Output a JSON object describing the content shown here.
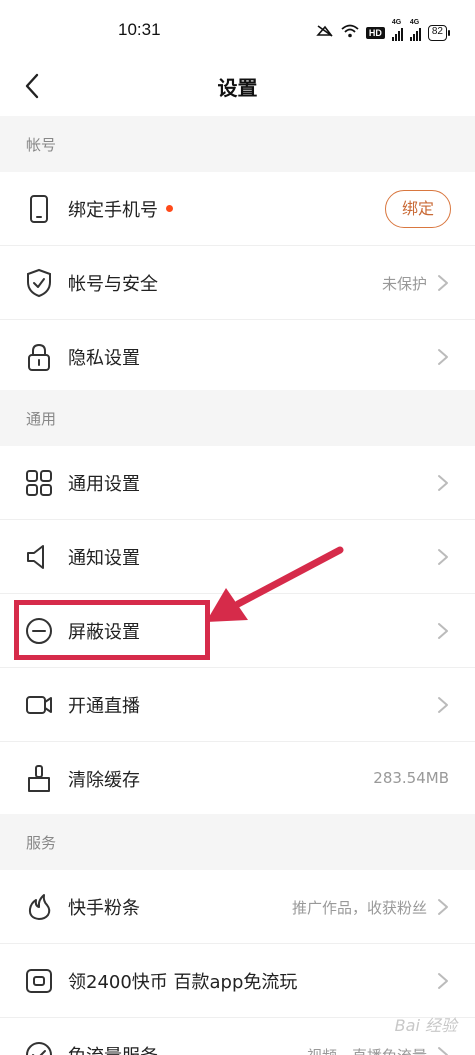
{
  "status_bar": {
    "time": "10:31",
    "network_gen": "4G",
    "hd_label": "HD",
    "battery": "82"
  },
  "nav": {
    "title": "设置"
  },
  "sections": {
    "account": {
      "header": "帐号",
      "bind_phone": {
        "label": "绑定手机号",
        "button": "绑定"
      },
      "account_security": {
        "label": "帐号与安全",
        "value": "未保护"
      },
      "privacy": {
        "label": "隐私设置"
      }
    },
    "general": {
      "header": "通用",
      "general_settings": {
        "label": "通用设置"
      },
      "notification_settings": {
        "label": "通知设置"
      },
      "block_settings": {
        "label": "屏蔽设置"
      },
      "live_stream": {
        "label": "开通直播"
      },
      "clear_cache": {
        "label": "清除缓存",
        "value": "283.54MB"
      }
    },
    "services": {
      "header": "服务",
      "fans": {
        "label": "快手粉条",
        "value": "推广作品，收获粉丝"
      },
      "coins": {
        "label": "领2400快币 百款app免流玩"
      },
      "free_data": {
        "label": "免流量服务",
        "value": "视频、直播免流量"
      }
    }
  },
  "watermark": "Bai 经验",
  "colors": {
    "accent_dot": "#ff4a1a",
    "bind_button": "#d9773f",
    "highlight": "#d62b4a"
  },
  "icons": {
    "back": "chevron-left-icon",
    "phone": "phone-icon",
    "shield": "shield-check-icon",
    "lock": "lock-icon",
    "grid": "grid-icon",
    "speaker": "speaker-icon",
    "block": "block-icon",
    "camera": "video-camera-icon",
    "broom": "broom-icon",
    "fans": "flame-icon",
    "coins": "coin-card-icon",
    "free_data": "data-icon",
    "chevron": "chevron-right-icon"
  }
}
